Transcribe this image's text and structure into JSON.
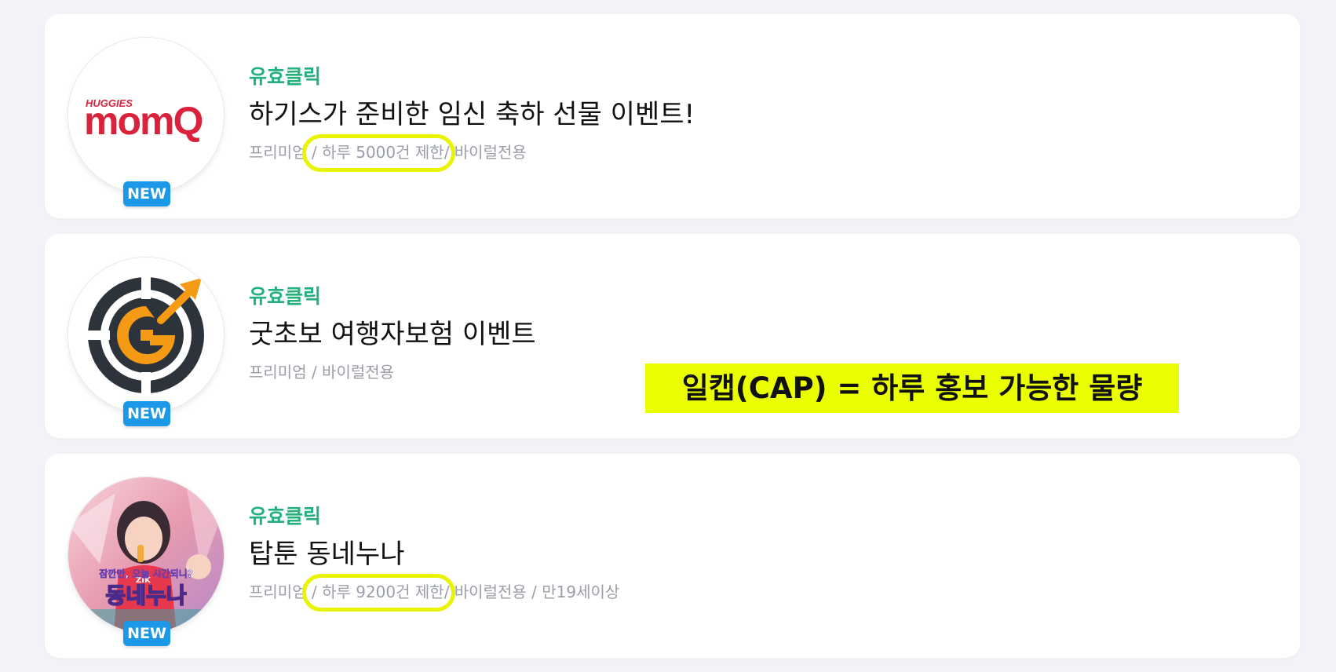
{
  "items": [
    {
      "category": "유효클릭",
      "title": "하기스가 준비한 임신 축하 선물 이벤트!",
      "meta_before": "프리미엄 ",
      "meta_highlight": "/ 하루 5000건 제한 ",
      "meta_after": "/ 바이럴전용",
      "badge": "NEW",
      "thumb_brand_small": "HUGGIES",
      "thumb_brand_main": "momQ"
    },
    {
      "category": "유효클릭",
      "title": "굿초보 여행자보험 이벤트",
      "meta": "프리미엄 / 바이럴전용",
      "badge": "NEW"
    },
    {
      "category": "유효클릭",
      "title": "탑툰 동네누나",
      "meta_before": "프리미엄 ",
      "meta_highlight": "/ 하루 9200건 제한 ",
      "meta_after": "/ 바이럴전용 / 만19세이상",
      "badge": "NEW",
      "thumb_caption_top": "잠깐만, 오늘 시간되니?",
      "thumb_caption_main": "동네누나"
    }
  ],
  "annotation": {
    "cap_text": "일캡(CAP) = 하루 홍보 가능한 물량",
    "highlight_color": "#eaff00"
  },
  "colors": {
    "category_green": "#23b07c",
    "badge_blue": "#1b98e8",
    "meta_gray": "#9a9ea8",
    "brand_red": "#d9233c",
    "logo_orange": "#f59a14",
    "logo_dark": "#2c333a"
  }
}
